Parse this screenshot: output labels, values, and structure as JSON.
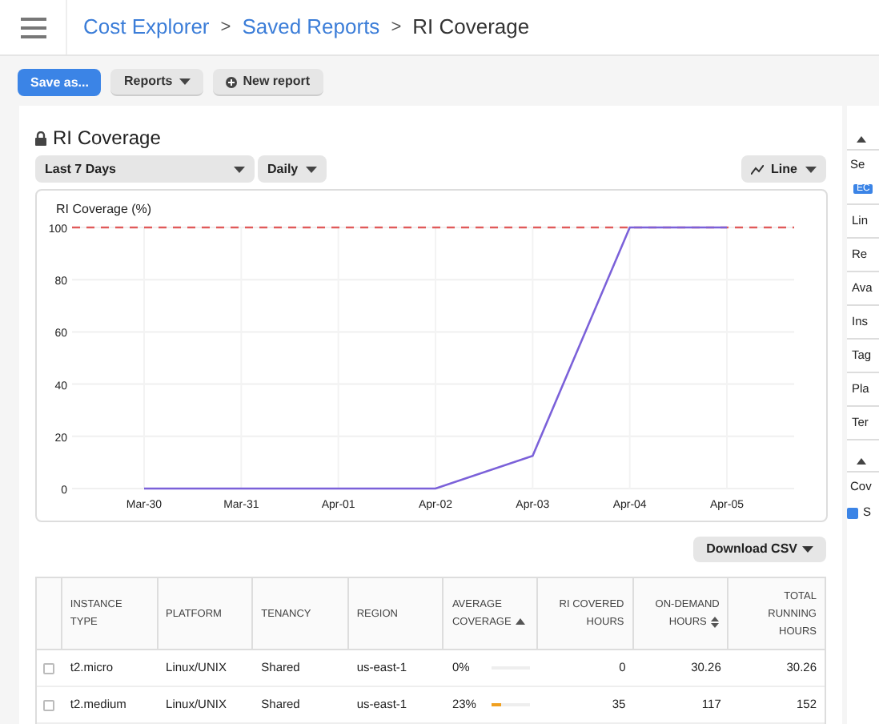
{
  "breadcrumbs": [
    {
      "label": "Cost Explorer",
      "kind": "link"
    },
    {
      "label": "Saved Reports",
      "kind": "link"
    },
    {
      "label": "RI Coverage",
      "kind": "current"
    }
  ],
  "breadcrumb_separator": ">",
  "toolbar": [
    {
      "label": "Save as...",
      "kind": "primary"
    },
    {
      "label": "Reports",
      "kind": "dropdown"
    },
    {
      "label": "New report",
      "kind": "add"
    }
  ],
  "report": {
    "title": "RI Coverage",
    "locked": true,
    "controls": [
      {
        "label": "Last 7 Days",
        "kind": "wide"
      },
      {
        "label": "Daily",
        "kind": "narrow"
      },
      {
        "label": "Line",
        "kind": "charttype"
      }
    ],
    "chart_data": {
      "type": "line",
      "title": "RI Coverage (%)",
      "categories": [
        "Mar-30",
        "Mar-31",
        "Apr-01",
        "Apr-02",
        "Apr-03",
        "Apr-04",
        "Apr-05"
      ],
      "values": [
        0,
        0,
        0,
        0,
        12.5,
        100,
        100
      ],
      "ylim": [
        0,
        100
      ],
      "yticks": [
        0,
        20,
        40,
        60,
        80,
        100
      ],
      "grid": true
    },
    "full_coverage_line": true,
    "download": "Download CSV",
    "table": {
      "columns": [
        {
          "label": "INSTANCE TYPE"
        },
        {
          "label": "PLATFORM"
        },
        {
          "label": "TENANCY"
        },
        {
          "label": "REGION"
        },
        {
          "label": "AVERAGE COVERAGE",
          "sorted_ascending": true
        },
        {
          "label": "RI COVERED HOURS"
        },
        {
          "label": "ON-DEMAND HOURS",
          "sortable": true
        },
        {
          "label": "TOTAL RUNNING HOURS"
        }
      ],
      "rows": [
        {
          "checked": false,
          "instance_type": "t2.micro",
          "platform": "Linux/UNIX",
          "tenancy": "Shared",
          "region": "us-east-1",
          "coverage": "0%",
          "level": 0,
          "ri_hours": "0",
          "on_demand": "30.26",
          "total": "30.26"
        },
        {
          "checked": false,
          "instance_type": "t2.medium",
          "platform": "Linux/UNIX",
          "tenancy": "Shared",
          "region": "us-east-1",
          "coverage": "23%",
          "level": 0.23,
          "ri_hours": "35",
          "on_demand": "117",
          "total": "152"
        }
      ]
    }
  },
  "sidebar": {
    "sections": [
      {
        "items": [
          {
            "label": "Se",
            "kind": "text"
          },
          {
            "label": "EC",
            "kind": "tag"
          },
          {
            "label": "Lin",
            "kind": "row"
          },
          {
            "label": "Re",
            "kind": "row"
          },
          {
            "label": "Ava",
            "kind": "row"
          },
          {
            "label": "Ins",
            "kind": "row"
          },
          {
            "label": "Tag",
            "kind": "row"
          },
          {
            "label": "Pla",
            "kind": "row"
          },
          {
            "label": "Ter",
            "kind": "row"
          }
        ]
      },
      {
        "items": [
          {
            "label": "Cov",
            "kind": "text"
          },
          {
            "label": "S",
            "kind": "checkbox",
            "checked": true
          }
        ]
      }
    ]
  }
}
